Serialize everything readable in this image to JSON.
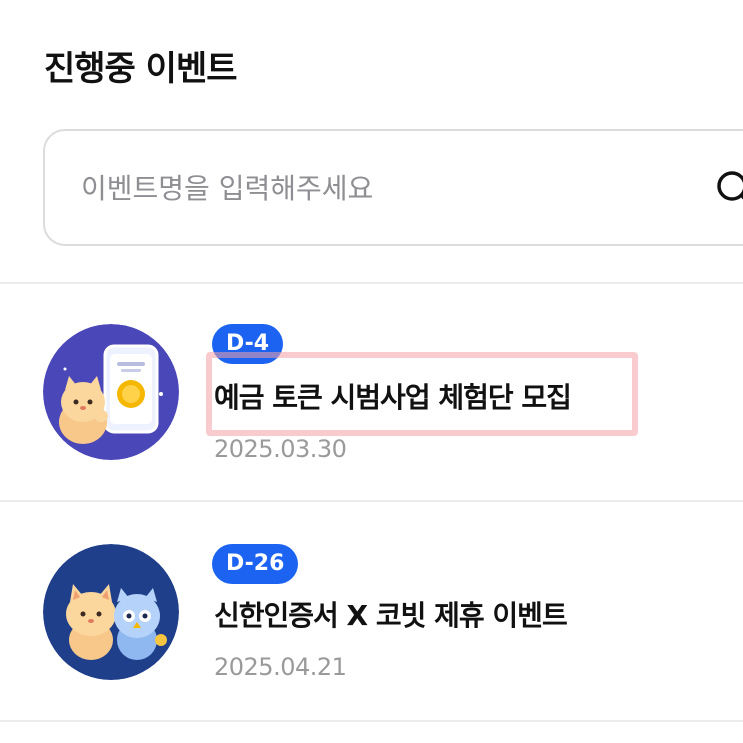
{
  "header": {
    "title": "진행중 이벤트"
  },
  "search": {
    "placeholder": "이벤트명을 입력해주세요",
    "value": "",
    "icon": "search-icon"
  },
  "events": [
    {
      "badge": "D-4",
      "title": "예금 토큰 시범사업 체험단 모집",
      "date": "2025.03.30",
      "thumbnail": "cat-with-phone-illustration"
    },
    {
      "badge": "D-26",
      "title": "신한인증서 X 코빗 제휴 이벤트",
      "date": "2025.04.21",
      "thumbnail": "cat-and-owl-illustration"
    }
  ],
  "colors": {
    "badge": "#1c63f2",
    "highlight": "#f4a0a8",
    "thumb1_bg": "#4a47b8",
    "thumb2_bg": "#1f3f8a"
  }
}
